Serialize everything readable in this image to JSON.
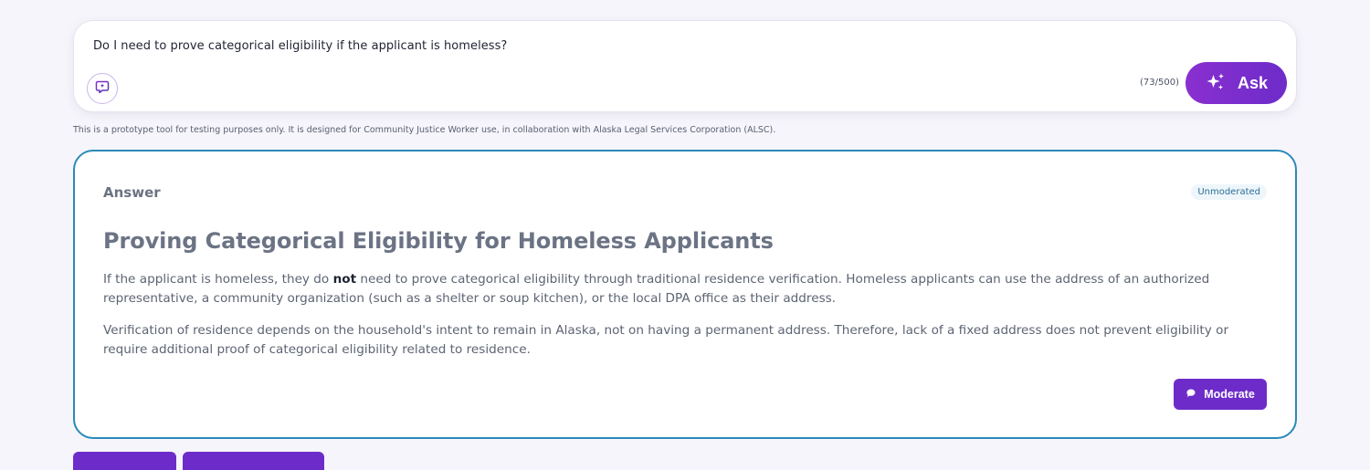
{
  "query": {
    "text": "Do I need to prove categorical eligibility if the applicant is homeless?",
    "char_count": "(73/500)",
    "ask_label": "Ask"
  },
  "disclaimer": "This is a prototype tool for testing purposes only. It is designed for Community Justice Worker use, in collaboration with Alaska Legal Services Corporation (ALSC).",
  "answer": {
    "label": "Answer",
    "status": "Unmoderated",
    "title": "Proving Categorical Eligibility for Homeless Applicants",
    "para1_before": "If the applicant is homeless, they do ",
    "para1_bold": "not",
    "para1_after": " need to prove categorical eligibility through traditional residence verification. Homeless applicants can use the address of an authorized representative, a community organization (such as a shelter or soup kitchen), or the local DPA office as their address.",
    "para2": "Verification of residence depends on the household's intent to remain in Alaska, not on having a permanent address. Therefore, lack of a fixed address does not prevent eligibility or require additional proof of categorical eligibility related to residence.",
    "moderate_label": "Moderate"
  },
  "icons": {
    "chat": "chat-sparkle-icon",
    "ask": "sparkles-icon",
    "moderate": "chat-bubble-icon"
  },
  "colors": {
    "accent": "#6d2cc9",
    "ask_gradient_start": "#8a2fd0",
    "card_border": "#2a8ab8"
  }
}
